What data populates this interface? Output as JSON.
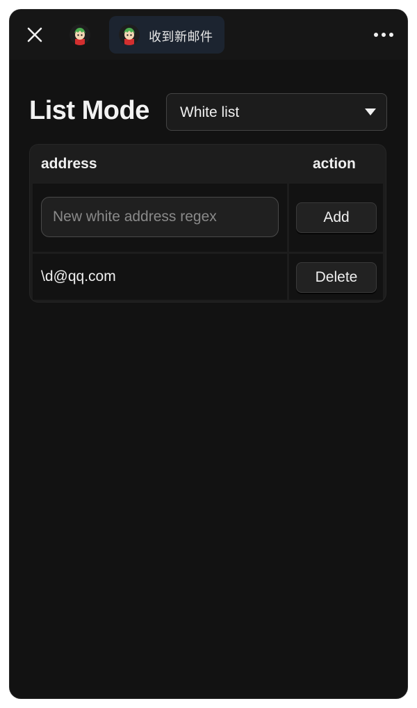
{
  "titlebar": {
    "close_icon": "close-icon",
    "more_icon": "more-horizontal-icon",
    "tab": {
      "label": "收到新邮件"
    }
  },
  "page": {
    "title": "List Mode",
    "mode_select": {
      "value": "White list",
      "icon": "caret-down-icon"
    }
  },
  "table": {
    "columns": [
      "address",
      "action"
    ],
    "new_row": {
      "input_placeholder": "New white address regex",
      "input_value": "",
      "button_label": "Add"
    },
    "rows": [
      {
        "address": "\\d@qq.com",
        "button_label": "Delete"
      }
    ]
  },
  "colors": {
    "window_bg": "#121212",
    "tab_bg": "#1c2430",
    "text": "#f0f0f0",
    "hair_green": "#4caf50",
    "shirt_red": "#d32f2f"
  }
}
